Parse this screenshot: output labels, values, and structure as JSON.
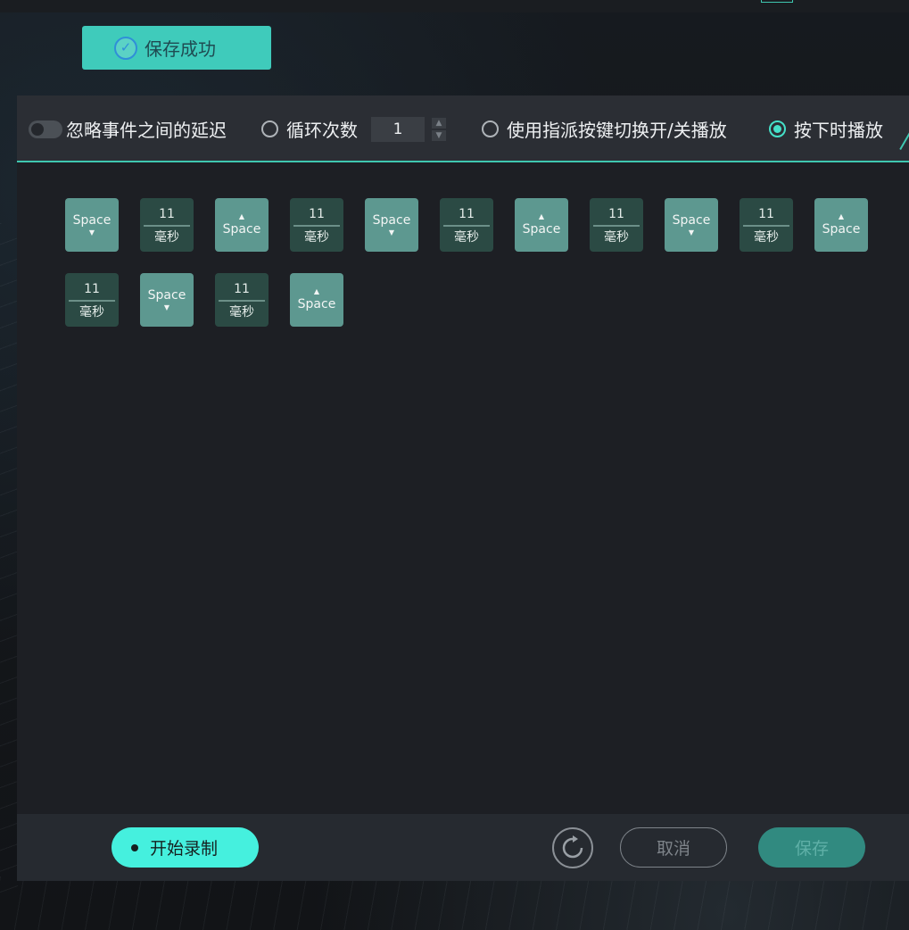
{
  "toast": {
    "text": "保存成功",
    "icon": "check-circle-icon"
  },
  "options": {
    "ignore_delay_label": "忽略事件之间的延迟",
    "loop_label": "循环次数",
    "loop_value": "1",
    "toggle_key_label": "使用指派按键切换开/关播放",
    "hold_play_label": "按下时播放",
    "selected": "hold_play"
  },
  "sequence": [
    {
      "type": "key",
      "label": "Space",
      "direction": "down"
    },
    {
      "type": "delay",
      "value": "11",
      "unit": "毫秒"
    },
    {
      "type": "key",
      "label": "Space",
      "direction": "up"
    },
    {
      "type": "delay",
      "value": "11",
      "unit": "毫秒"
    },
    {
      "type": "key",
      "label": "Space",
      "direction": "down"
    },
    {
      "type": "delay",
      "value": "11",
      "unit": "毫秒"
    },
    {
      "type": "key",
      "label": "Space",
      "direction": "up"
    },
    {
      "type": "delay",
      "value": "11",
      "unit": "毫秒"
    },
    {
      "type": "key",
      "label": "Space",
      "direction": "down"
    },
    {
      "type": "delay",
      "value": "11",
      "unit": "毫秒"
    },
    {
      "type": "key",
      "label": "Space",
      "direction": "up"
    },
    {
      "type": "delay",
      "value": "11",
      "unit": "毫秒"
    },
    {
      "type": "key",
      "label": "Space",
      "direction": "down"
    },
    {
      "type": "delay",
      "value": "11",
      "unit": "毫秒"
    },
    {
      "type": "key",
      "label": "Space",
      "direction": "up"
    }
  ],
  "footer": {
    "record_label": "开始录制",
    "cancel_label": "取消",
    "save_label": "保存",
    "refresh_icon": "refresh-icon"
  },
  "colors": {
    "accent": "#45f0de",
    "toast_bg": "#3fcbbb",
    "key_tile": "#5d9890",
    "delay_tile": "#2b4a44",
    "save_button": "#318a80"
  }
}
